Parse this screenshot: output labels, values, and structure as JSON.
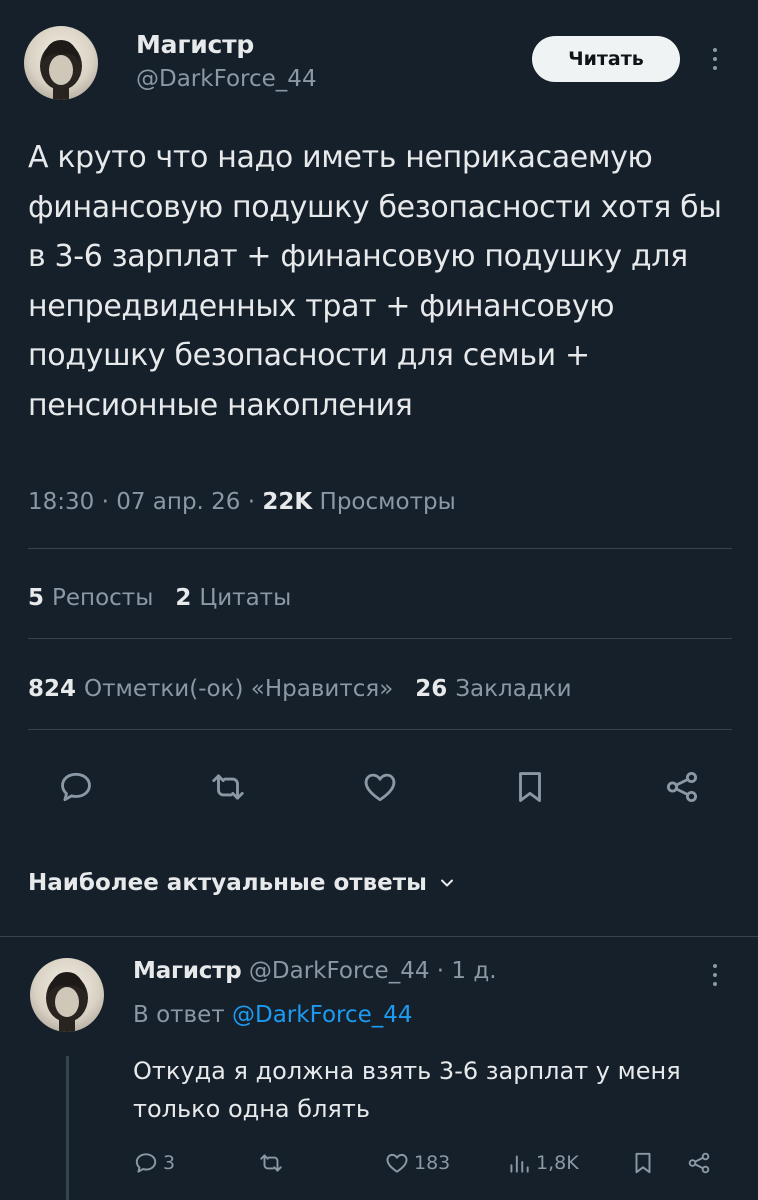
{
  "post": {
    "author_name": "Магистр",
    "author_handle": "@DarkForce_44",
    "follow_label": "Читать",
    "text": "А круто что надо иметь неприкасаемую финансовую подушку безопасности хотя бы в 3-6 зарплат + финансовую подушку для непредвиденных трат + финансовую подушку безопасности для семьи + пенсионные накопления",
    "time": "18:30",
    "date": "07 апр. 26",
    "views_count": "22K",
    "views_label": "Просмотры",
    "reposts_count": "5",
    "reposts_label": "Репосты",
    "quotes_count": "2",
    "quotes_label": "Цитаты",
    "likes_count": "824",
    "likes_label": "Отметки(-ок) «Нравится»",
    "bookmarks_count": "26",
    "bookmarks_label": "Закладки"
  },
  "actions": [
    "reply-icon",
    "repost-icon",
    "like-icon",
    "bookmark-icon",
    "share-icon"
  ],
  "replies_sort": {
    "label": "Наиболее актуальные ответы"
  },
  "reply": {
    "author_name": "Магистр",
    "author_handle": "@DarkForce_44",
    "age": "1 д.",
    "reply_to_prefix": "В ответ",
    "reply_to_handle": "@DarkForce_44",
    "text": "Откуда я должна взять 3-6 зарплат у меня только одна блять",
    "reply_count": "3",
    "views_count": "183",
    "analytics_count": "1,8K"
  },
  "colors": {
    "background": "#15202b",
    "text": "#e7e9ea",
    "muted": "#8b98a5",
    "link": "#1d9bf0",
    "divider": "#38444d",
    "button_bg": "#eff3f4"
  }
}
